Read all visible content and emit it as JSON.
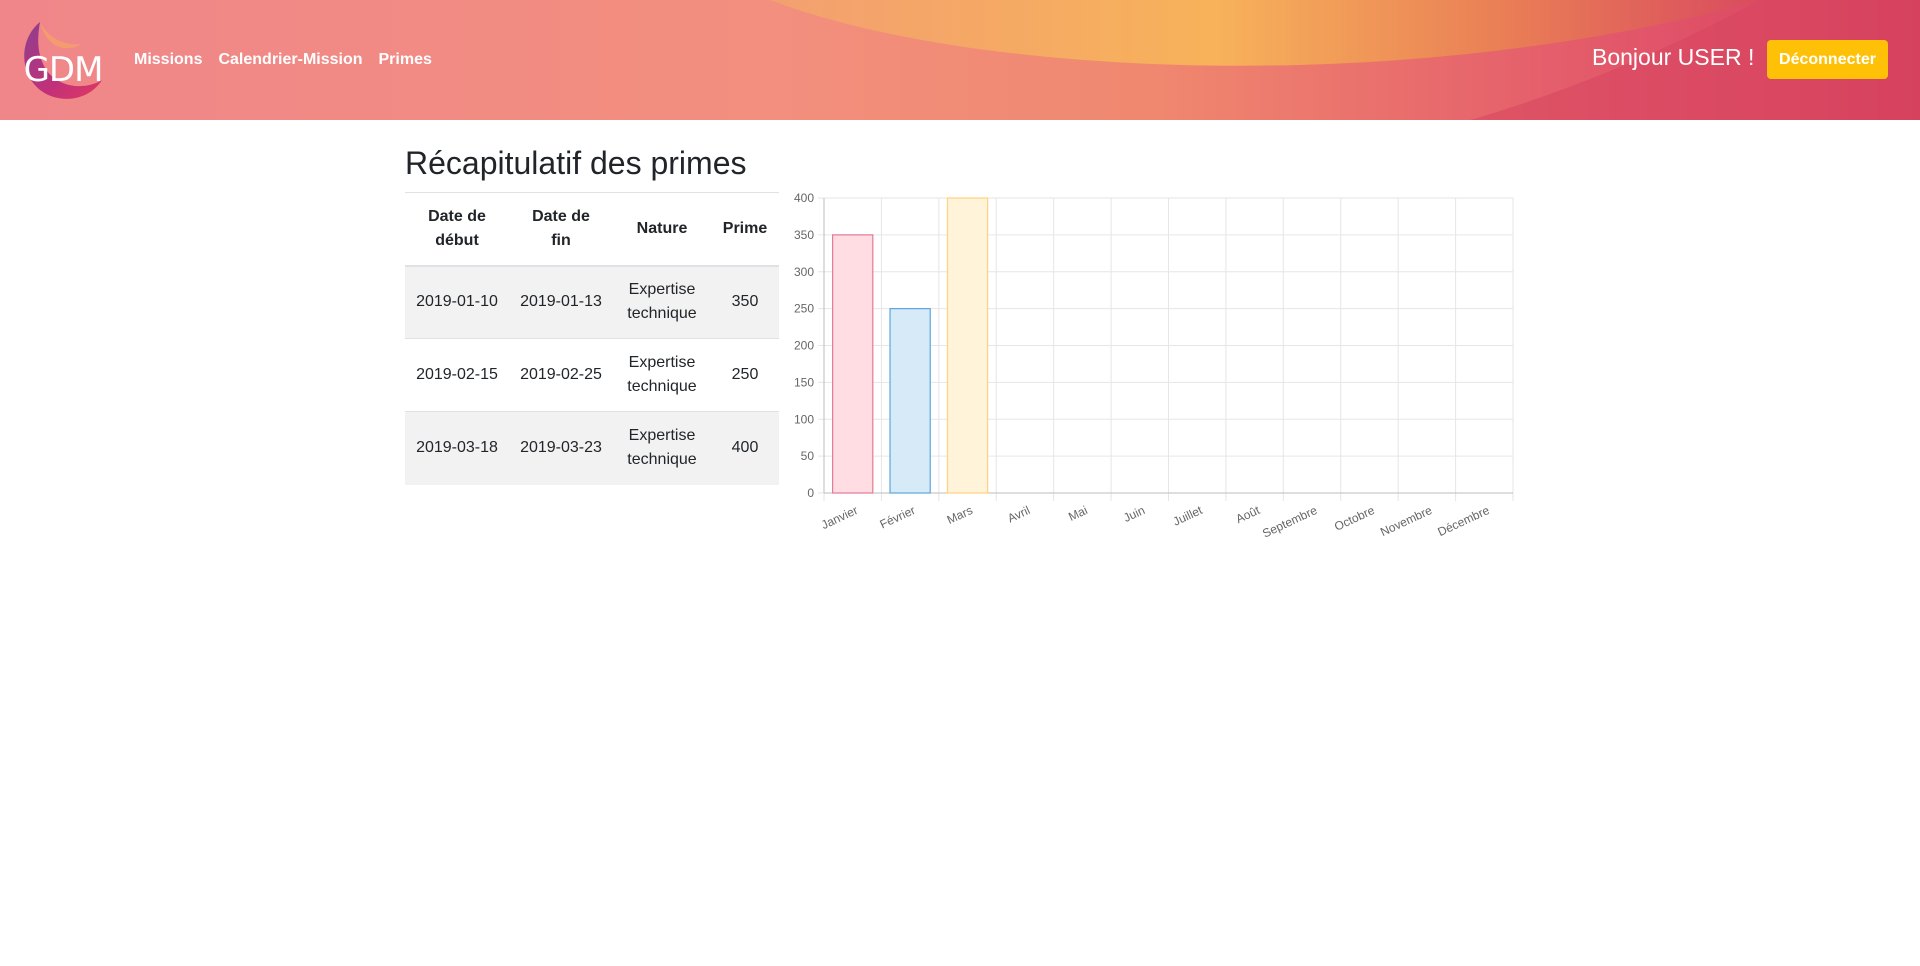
{
  "header": {
    "logo_text": "GDM",
    "nav": [
      "Missions",
      "Calendrier-Mission",
      "Primes"
    ],
    "greeting": "Bonjour USER !",
    "logout_label": "Déconnecter"
  },
  "page": {
    "title": "Récapitulatif des primes"
  },
  "table": {
    "headers": [
      "Date de\ndébut",
      "Date de\nfin",
      "Nature",
      "Prime"
    ],
    "rows": [
      {
        "start": "2019-01-10",
        "end": "2019-01-13",
        "nature": "Expertise technique",
        "prime": "350"
      },
      {
        "start": "2019-02-15",
        "end": "2019-02-25",
        "nature": "Expertise technique",
        "prime": "250"
      },
      {
        "start": "2019-03-18",
        "end": "2019-03-23",
        "nature": "Expertise technique",
        "prime": "400"
      }
    ]
  },
  "chart_data": {
    "type": "bar",
    "categories": [
      "Janvier",
      "Février",
      "Mars",
      "Avril",
      "Mai",
      "Juin",
      "Juillet",
      "Août",
      "Septembre",
      "Octobre",
      "Novembre",
      "Décembre"
    ],
    "values": [
      350,
      250,
      400,
      0,
      0,
      0,
      0,
      0,
      0,
      0,
      0,
      0
    ],
    "ylim": [
      0,
      400
    ],
    "yticks": [
      0,
      50,
      100,
      150,
      200,
      250,
      300,
      350,
      400
    ],
    "grid": true,
    "bar_fill": [
      "#ffdde3",
      "#d6eaf8",
      "#fff3d9"
    ],
    "bar_stroke": [
      "#e57a95",
      "#5ba7df",
      "#ffd27f"
    ],
    "title": "",
    "xlabel": "",
    "ylabel": ""
  }
}
